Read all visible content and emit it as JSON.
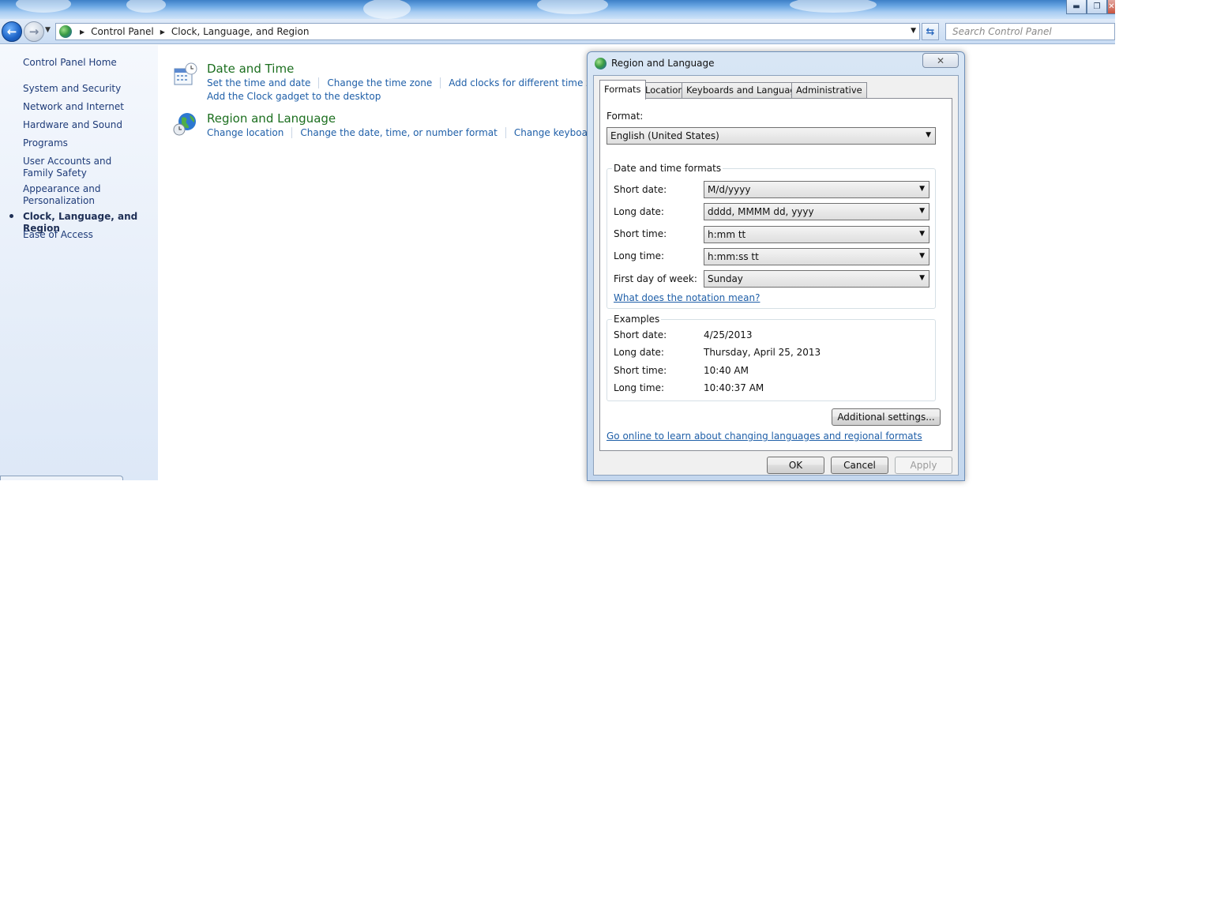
{
  "explorer": {
    "breadcrumb": [
      "Control Panel",
      "Clock, Language, and Region"
    ],
    "search_placeholder": "Search Control Panel",
    "sidebar": {
      "home": "Control Panel Home",
      "items": [
        {
          "label": "System and Security"
        },
        {
          "label": "Network and Internet"
        },
        {
          "label": "Hardware and Sound"
        },
        {
          "label": "Programs"
        },
        {
          "label": "User Accounts and Family Safety"
        },
        {
          "label": "Appearance and Personalization"
        },
        {
          "label": "Clock, Language, and Region",
          "current": true
        },
        {
          "label": "Ease of Access"
        }
      ]
    },
    "categories": [
      {
        "title": "Date and Time",
        "icon": "calendar-clock-icon",
        "tasks": [
          "Set the time and date",
          "Change the time zone",
          "Add clocks for different time zones"
        ],
        "tasks_line2": [
          "Add the Clock gadget to the desktop"
        ]
      },
      {
        "title": "Region and Language",
        "icon": "globe-clock-icon",
        "tasks": [
          "Change location",
          "Change the date, time, or number format",
          "Change keyboards or oth"
        ]
      }
    ]
  },
  "dialog": {
    "title": "Region and Language",
    "close_glyph": "✕",
    "tabs": [
      {
        "label": "Formats",
        "active": true
      },
      {
        "label": "Location"
      },
      {
        "label": "Keyboards and Languages"
      },
      {
        "label": "Administrative"
      }
    ],
    "format_label": "Format:",
    "format_value": "English (United States)",
    "date_time_group": {
      "title": "Date and time formats",
      "rows": [
        {
          "label": "Short date:",
          "value": "M/d/yyyy"
        },
        {
          "label": "Long date:",
          "value": "dddd, MMMM dd, yyyy"
        },
        {
          "label": "Short time:",
          "value": "h:mm tt"
        },
        {
          "label": "Long time:",
          "value": "h:mm:ss tt"
        },
        {
          "label": "First day of week:",
          "value": "Sunday"
        }
      ],
      "notation_link": "What does the notation mean?"
    },
    "examples_group": {
      "title": "Examples",
      "rows": [
        {
          "label": "Short date:",
          "value": "4/25/2013"
        },
        {
          "label": "Long date:",
          "value": "Thursday, April 25, 2013"
        },
        {
          "label": "Short time:",
          "value": "10:40 AM"
        },
        {
          "label": "Long time:",
          "value": "10:40:37 AM"
        }
      ]
    },
    "additional_settings": "Additional settings...",
    "online_link": "Go online to learn about changing languages and regional formats",
    "buttons": {
      "ok": "OK",
      "cancel": "Cancel",
      "apply": "Apply"
    }
  }
}
